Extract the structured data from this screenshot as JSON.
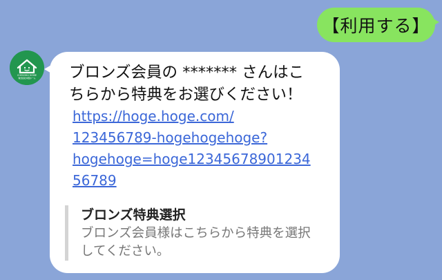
{
  "user_message": {
    "text": "【利用する】"
  },
  "bot_avatar": {
    "logo_text": "CHEGOKU HOME",
    "logo_sub": "株式会社中国ホーム",
    "icon": "house-logo-icon",
    "bg_color": "#22964f"
  },
  "bot_message": {
    "text": "ブロンズ会員の ******* さんはこ\nちらから特典をお選びください！",
    "link": "https://hoge.hoge.com/\n123456789-hogehogehoge?\nhogehoge=hoge12345678901234\n56789",
    "preview": {
      "title": "ブロンズ特典選択",
      "description": "ブロンズ会員様はこちらから特典を選択\nしてください。"
    }
  },
  "colors": {
    "background": "#8aa5d8",
    "user_bubble": "#88e45f",
    "bot_bubble": "#ffffff",
    "link": "#3b67d8"
  }
}
